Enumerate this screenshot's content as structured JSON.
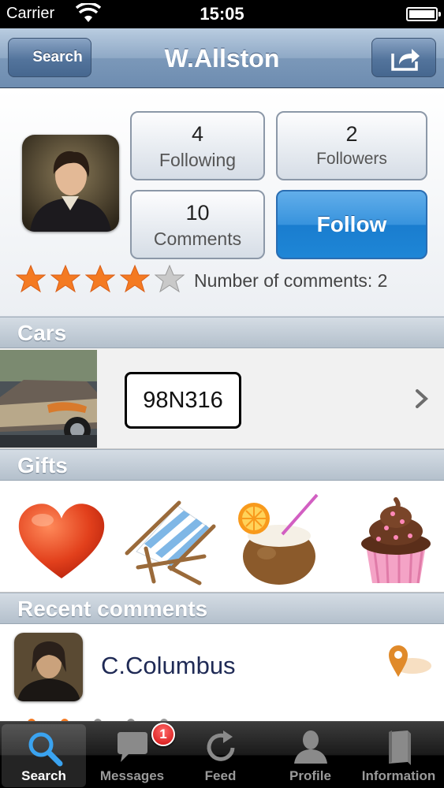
{
  "status_bar": {
    "carrier": "Carrier",
    "time": "15:05"
  },
  "nav": {
    "back_label": "Search",
    "title": "W.Allston",
    "share_icon": "share-icon"
  },
  "profile": {
    "following_count": "4",
    "following_label": "Following",
    "followers_count": "2",
    "followers_label": "Followers",
    "comments_count": "10",
    "comments_label": "Comments",
    "follow_label": "Follow",
    "rating": 4,
    "rating_max": 5,
    "number_of_comments_text": "Number of comments: 2"
  },
  "sections": {
    "cars": "Cars",
    "gifts": "Gifts",
    "recent_comments": "Recent comments"
  },
  "cars": [
    {
      "plate": "98N316"
    }
  ],
  "gifts": [
    {
      "icon": "heart-icon"
    },
    {
      "icon": "beach-chair-icon"
    },
    {
      "icon": "coconut-cocktail-icon"
    },
    {
      "icon": "cupcake-icon"
    }
  ],
  "recent_comments": [
    {
      "author": "C.Columbus",
      "icon": "location-pin-icon"
    }
  ],
  "tabs": [
    {
      "label": "Search",
      "icon": "search-icon",
      "active": true
    },
    {
      "label": "Messages",
      "icon": "speech-bubble-icon",
      "badge": "1"
    },
    {
      "label": "Feed",
      "icon": "refresh-icon"
    },
    {
      "label": "Profile",
      "icon": "person-icon"
    },
    {
      "label": "Information",
      "icon": "book-icon"
    }
  ],
  "colors": {
    "accent": "#1e86d6",
    "star": "#f47a22",
    "name": "#1f2a55"
  }
}
